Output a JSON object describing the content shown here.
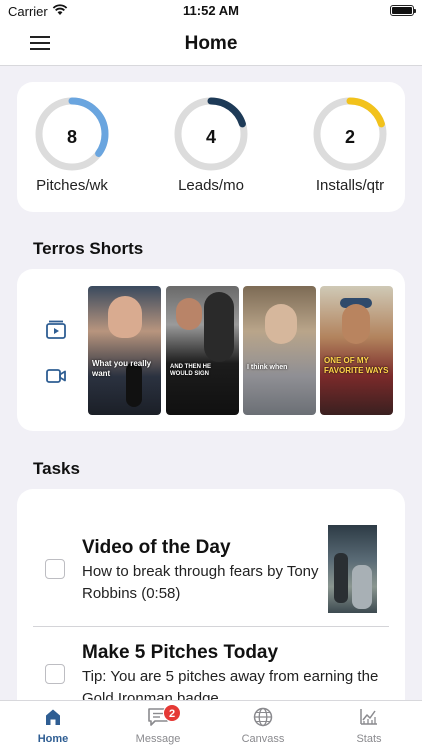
{
  "status_bar": {
    "carrier": "Carrier",
    "time": "11:52 AM"
  },
  "header": {
    "title": "Home"
  },
  "stats": [
    {
      "value": "8",
      "label": "Pitches/wk",
      "progress": 0.35,
      "color": "#6aa5df"
    },
    {
      "value": "4",
      "label": "Leads/mo",
      "progress": 0.2,
      "color": "#1d3a57"
    },
    {
      "value": "2",
      "label": "Installs/qtr",
      "progress": 0.2,
      "color": "#f2c21b"
    }
  ],
  "shorts": {
    "title": "Terros Shorts",
    "icons": [
      "video-library-icon",
      "video-camera-icon"
    ],
    "captions": [
      "What you really want",
      "AND THEN HE WOULD SIGN",
      "I think when",
      "ONE OF MY FAVORITE WAYS"
    ]
  },
  "tasks": {
    "title": "Tasks",
    "items": [
      {
        "title": "Video of the Day",
        "description": "How to break through fears by Tony Robbins (0:58)"
      },
      {
        "title": "Make 5 Pitches Today",
        "description": "Tip: You are 5 pitches away from earning the Gold Ironman badge"
      }
    ]
  },
  "tabbar": {
    "tabs": [
      {
        "label": "Home",
        "icon": "home-icon",
        "active": true
      },
      {
        "label": "Message",
        "icon": "message-icon",
        "badge": "2"
      },
      {
        "label": "Canvass",
        "icon": "globe-icon"
      },
      {
        "label": "Stats",
        "icon": "stats-icon"
      }
    ]
  },
  "colors": {
    "accent": "#2f5e93",
    "badge": "#e53935"
  }
}
